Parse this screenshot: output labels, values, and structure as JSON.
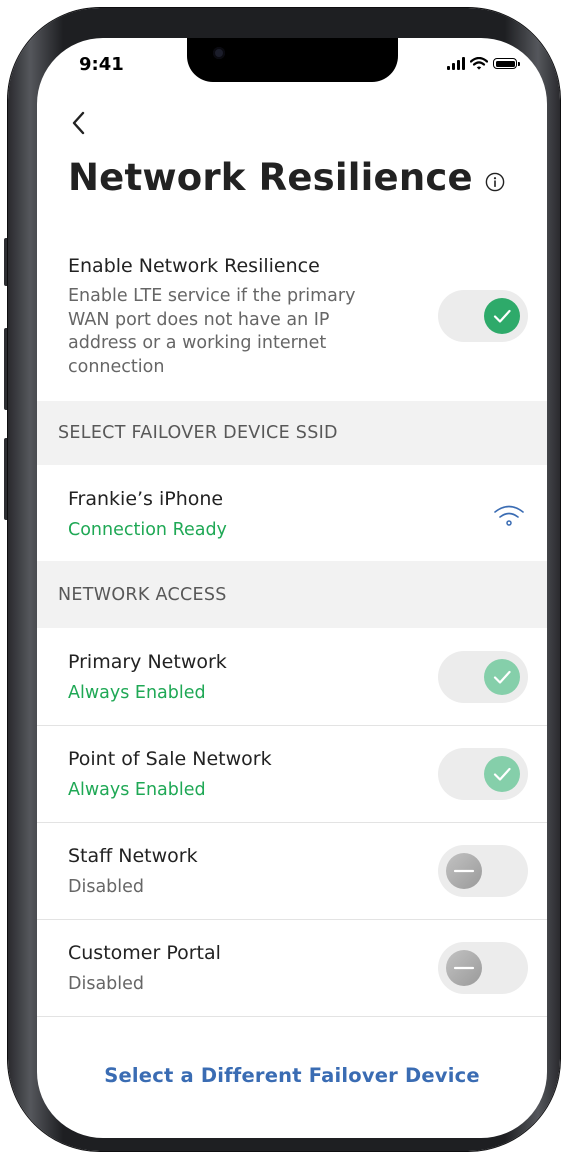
{
  "status_bar": {
    "time": "9:41"
  },
  "header": {
    "title": "Network Resilience"
  },
  "resilience": {
    "label": "Enable Network Resilience",
    "description": "Enable LTE service if the primary WAN port does not have an IP address or a working internet connection",
    "enabled": true
  },
  "failover_section": {
    "heading": "SELECT FAILOVER DEVICE SSID"
  },
  "device": {
    "name": "Frankie’s iPhone",
    "status": "Connection Ready"
  },
  "access_section": {
    "heading": "NETWORK ACCESS"
  },
  "networks": [
    {
      "label": "Primary Network",
      "status": "Always Enabled",
      "state": "on-locked"
    },
    {
      "label": "Point of Sale Network",
      "status": "Always Enabled",
      "state": "on-locked"
    },
    {
      "label": "Staff Network",
      "status": "Disabled",
      "state": "off"
    },
    {
      "label": "Customer Portal",
      "status": "Disabled",
      "state": "off"
    }
  ],
  "footer": {
    "link": "Select a Different Failover Device"
  },
  "colors": {
    "accent_green": "#2eaa6a",
    "status_green": "#1fa855",
    "link_blue": "#3a6cb3"
  }
}
